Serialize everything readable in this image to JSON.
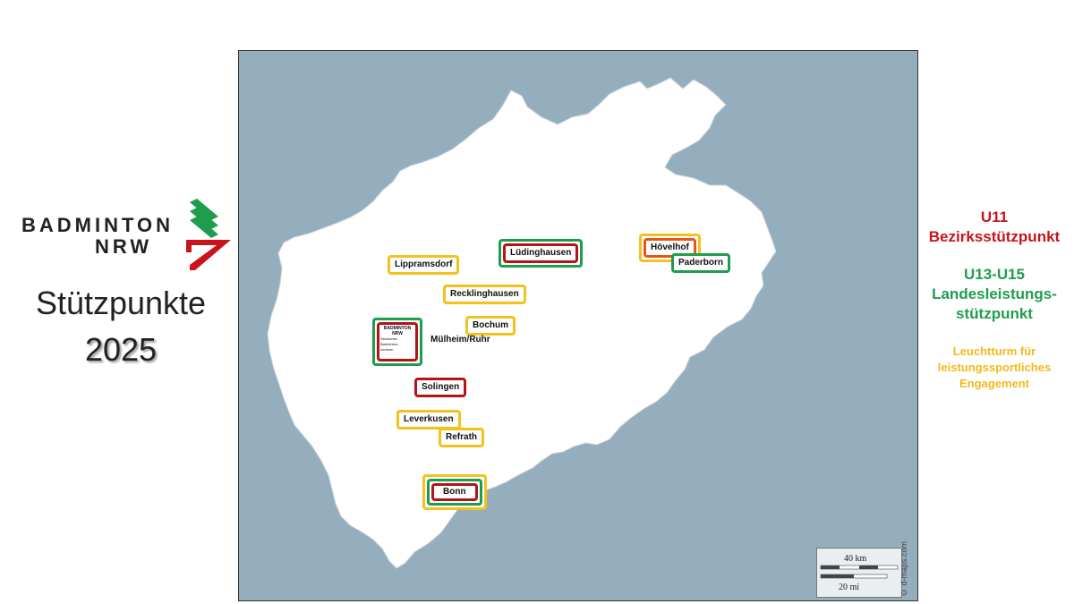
{
  "logo": {
    "line1": "BADMINTON",
    "line2": "NRW"
  },
  "title": "Stützpunkte",
  "year": "2025",
  "legend": {
    "u11_title": "U11",
    "u11_label": "Bezirksstützpunkt",
    "u13_title": "U13-U15",
    "u13_label_line1": "Landesleistungs-",
    "u13_label_line2": "stützpunkt",
    "leucht_line1": "Leuchtturm für",
    "leucht_line2": "leistungssportliches",
    "leucht_line3": "Engagement"
  },
  "colors": {
    "u11": "#c8141a",
    "u13_u15": "#1f9d4e",
    "leuchtturm": "#f3c21b",
    "sea_background": "#94aebd",
    "land": "#ffffff"
  },
  "cities": {
    "luedinghausen": "Lüdinghausen",
    "hoevelhof": "Hövelhof",
    "paderborn": "Paderborn",
    "lippramsdorf": "Lippramsdorf",
    "recklinghausen": "Recklinghausen",
    "bochum": "Bochum",
    "muelheim": "Mülheim/Ruhr",
    "solingen": "Solingen",
    "leverkusen": "Leverkusen",
    "refrath": "Refrath",
    "bonn": "Bonn"
  },
  "muelheim_logo": {
    "line1": "BADMINTON",
    "line2": "NRW",
    "line3": "Deutsches",
    "line4": "Badminton-",
    "line5": "zentrum"
  },
  "scale": {
    "km": "40 km",
    "mi": "20 mi"
  },
  "attribution": "© d-maps.com"
}
